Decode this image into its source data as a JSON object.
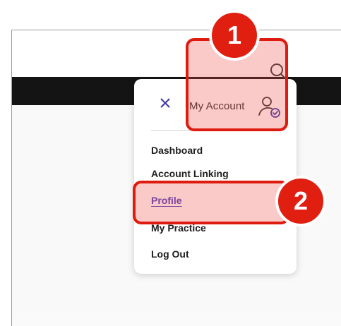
{
  "colors": {
    "annotation_red": "#dd1b0f",
    "highlight_fill": "rgba(236,80,72,0.30)",
    "active_link": "#4a3fbf",
    "header_bar": "#141414"
  },
  "header": {
    "search_icon": "search-icon"
  },
  "account_menu": {
    "close_icon": "close-icon",
    "title": "My Account",
    "account_icon": "user-check-icon",
    "items": [
      {
        "label": "Dashboard"
      },
      {
        "label": "Account Linking"
      },
      {
        "label": "Profile",
        "active": true
      },
      {
        "label": "My Practice"
      },
      {
        "label": "Log Out"
      }
    ]
  },
  "annotations": {
    "step1": "1",
    "step2": "2"
  }
}
